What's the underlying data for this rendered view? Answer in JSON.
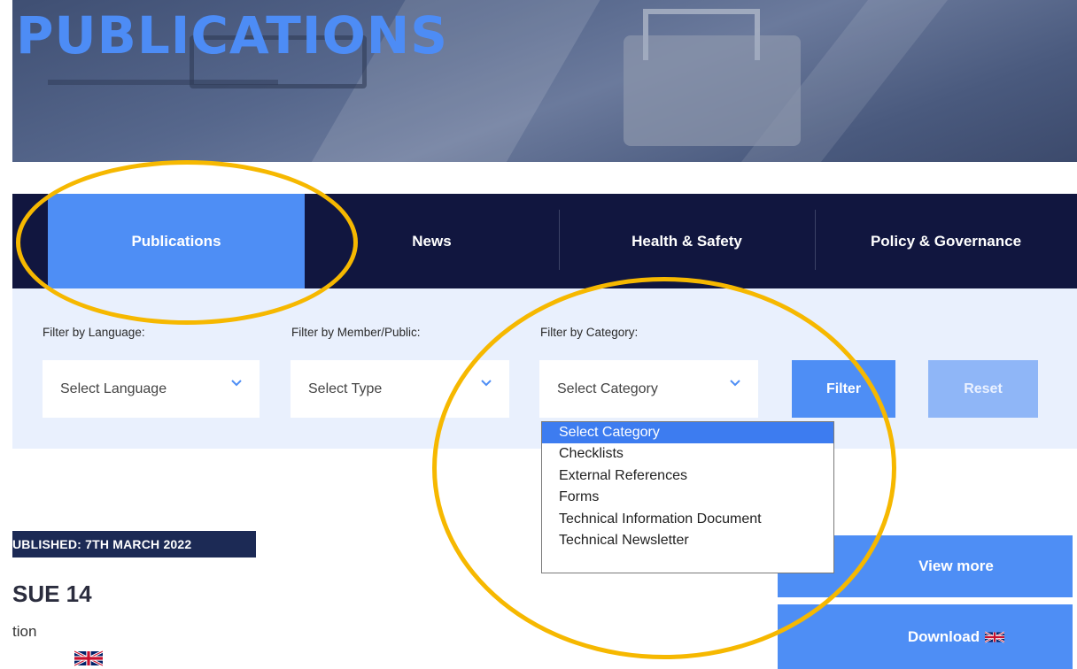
{
  "hero": {
    "title": "PUBLICATIONS"
  },
  "nav": {
    "items": [
      {
        "label": "Publications",
        "active": true
      },
      {
        "label": "News",
        "active": false
      },
      {
        "label": "Health & Safety",
        "active": false
      },
      {
        "label": "Policy & Governance",
        "active": false
      }
    ]
  },
  "filters": {
    "language": {
      "label": "Filter by Language:",
      "value": "Select Language"
    },
    "type": {
      "label": "Filter by Member/Public:",
      "value": "Select Type"
    },
    "category": {
      "label": "Filter by Category:",
      "value": "Select Category"
    },
    "filter_button": "Filter",
    "reset_button": "Reset"
  },
  "category_options": [
    "Select Category",
    "Checklists",
    "External References",
    "Forms",
    "Technical Information Document",
    "Technical Newsletter"
  ],
  "content": {
    "published": "UBLISHED:  7TH MARCH 2022",
    "issue": "SUE 14",
    "description": "tion",
    "view_more": "View more",
    "download": "Download"
  },
  "colors": {
    "accent": "#4e8ef5",
    "nav_bg": "#11163f",
    "highlight": "#f6b800"
  }
}
